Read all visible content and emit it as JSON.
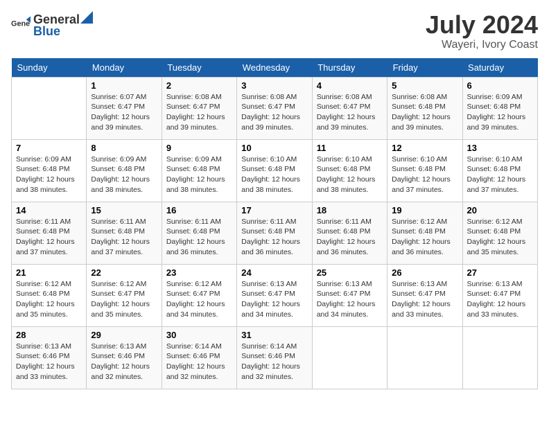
{
  "header": {
    "logo_general": "General",
    "logo_blue": "Blue",
    "month": "July 2024",
    "location": "Wayeri, Ivory Coast"
  },
  "weekdays": [
    "Sunday",
    "Monday",
    "Tuesday",
    "Wednesday",
    "Thursday",
    "Friday",
    "Saturday"
  ],
  "weeks": [
    [
      {
        "day": "",
        "info": ""
      },
      {
        "day": "1",
        "info": "Sunrise: 6:07 AM\nSunset: 6:47 PM\nDaylight: 12 hours\nand 39 minutes."
      },
      {
        "day": "2",
        "info": "Sunrise: 6:08 AM\nSunset: 6:47 PM\nDaylight: 12 hours\nand 39 minutes."
      },
      {
        "day": "3",
        "info": "Sunrise: 6:08 AM\nSunset: 6:47 PM\nDaylight: 12 hours\nand 39 minutes."
      },
      {
        "day": "4",
        "info": "Sunrise: 6:08 AM\nSunset: 6:47 PM\nDaylight: 12 hours\nand 39 minutes."
      },
      {
        "day": "5",
        "info": "Sunrise: 6:08 AM\nSunset: 6:48 PM\nDaylight: 12 hours\nand 39 minutes."
      },
      {
        "day": "6",
        "info": "Sunrise: 6:09 AM\nSunset: 6:48 PM\nDaylight: 12 hours\nand 39 minutes."
      }
    ],
    [
      {
        "day": "7",
        "info": "Sunrise: 6:09 AM\nSunset: 6:48 PM\nDaylight: 12 hours\nand 38 minutes."
      },
      {
        "day": "8",
        "info": "Sunrise: 6:09 AM\nSunset: 6:48 PM\nDaylight: 12 hours\nand 38 minutes."
      },
      {
        "day": "9",
        "info": "Sunrise: 6:09 AM\nSunset: 6:48 PM\nDaylight: 12 hours\nand 38 minutes."
      },
      {
        "day": "10",
        "info": "Sunrise: 6:10 AM\nSunset: 6:48 PM\nDaylight: 12 hours\nand 38 minutes."
      },
      {
        "day": "11",
        "info": "Sunrise: 6:10 AM\nSunset: 6:48 PM\nDaylight: 12 hours\nand 38 minutes."
      },
      {
        "day": "12",
        "info": "Sunrise: 6:10 AM\nSunset: 6:48 PM\nDaylight: 12 hours\nand 37 minutes."
      },
      {
        "day": "13",
        "info": "Sunrise: 6:10 AM\nSunset: 6:48 PM\nDaylight: 12 hours\nand 37 minutes."
      }
    ],
    [
      {
        "day": "14",
        "info": "Sunrise: 6:11 AM\nSunset: 6:48 PM\nDaylight: 12 hours\nand 37 minutes."
      },
      {
        "day": "15",
        "info": "Sunrise: 6:11 AM\nSunset: 6:48 PM\nDaylight: 12 hours\nand 37 minutes."
      },
      {
        "day": "16",
        "info": "Sunrise: 6:11 AM\nSunset: 6:48 PM\nDaylight: 12 hours\nand 36 minutes."
      },
      {
        "day": "17",
        "info": "Sunrise: 6:11 AM\nSunset: 6:48 PM\nDaylight: 12 hours\nand 36 minutes."
      },
      {
        "day": "18",
        "info": "Sunrise: 6:11 AM\nSunset: 6:48 PM\nDaylight: 12 hours\nand 36 minutes."
      },
      {
        "day": "19",
        "info": "Sunrise: 6:12 AM\nSunset: 6:48 PM\nDaylight: 12 hours\nand 36 minutes."
      },
      {
        "day": "20",
        "info": "Sunrise: 6:12 AM\nSunset: 6:48 PM\nDaylight: 12 hours\nand 35 minutes."
      }
    ],
    [
      {
        "day": "21",
        "info": "Sunrise: 6:12 AM\nSunset: 6:48 PM\nDaylight: 12 hours\nand 35 minutes."
      },
      {
        "day": "22",
        "info": "Sunrise: 6:12 AM\nSunset: 6:47 PM\nDaylight: 12 hours\nand 35 minutes."
      },
      {
        "day": "23",
        "info": "Sunrise: 6:12 AM\nSunset: 6:47 PM\nDaylight: 12 hours\nand 34 minutes."
      },
      {
        "day": "24",
        "info": "Sunrise: 6:13 AM\nSunset: 6:47 PM\nDaylight: 12 hours\nand 34 minutes."
      },
      {
        "day": "25",
        "info": "Sunrise: 6:13 AM\nSunset: 6:47 PM\nDaylight: 12 hours\nand 34 minutes."
      },
      {
        "day": "26",
        "info": "Sunrise: 6:13 AM\nSunset: 6:47 PM\nDaylight: 12 hours\nand 33 minutes."
      },
      {
        "day": "27",
        "info": "Sunrise: 6:13 AM\nSunset: 6:47 PM\nDaylight: 12 hours\nand 33 minutes."
      }
    ],
    [
      {
        "day": "28",
        "info": "Sunrise: 6:13 AM\nSunset: 6:46 PM\nDaylight: 12 hours\nand 33 minutes."
      },
      {
        "day": "29",
        "info": "Sunrise: 6:13 AM\nSunset: 6:46 PM\nDaylight: 12 hours\nand 32 minutes."
      },
      {
        "day": "30",
        "info": "Sunrise: 6:14 AM\nSunset: 6:46 PM\nDaylight: 12 hours\nand 32 minutes."
      },
      {
        "day": "31",
        "info": "Sunrise: 6:14 AM\nSunset: 6:46 PM\nDaylight: 12 hours\nand 32 minutes."
      },
      {
        "day": "",
        "info": ""
      },
      {
        "day": "",
        "info": ""
      },
      {
        "day": "",
        "info": ""
      }
    ]
  ]
}
